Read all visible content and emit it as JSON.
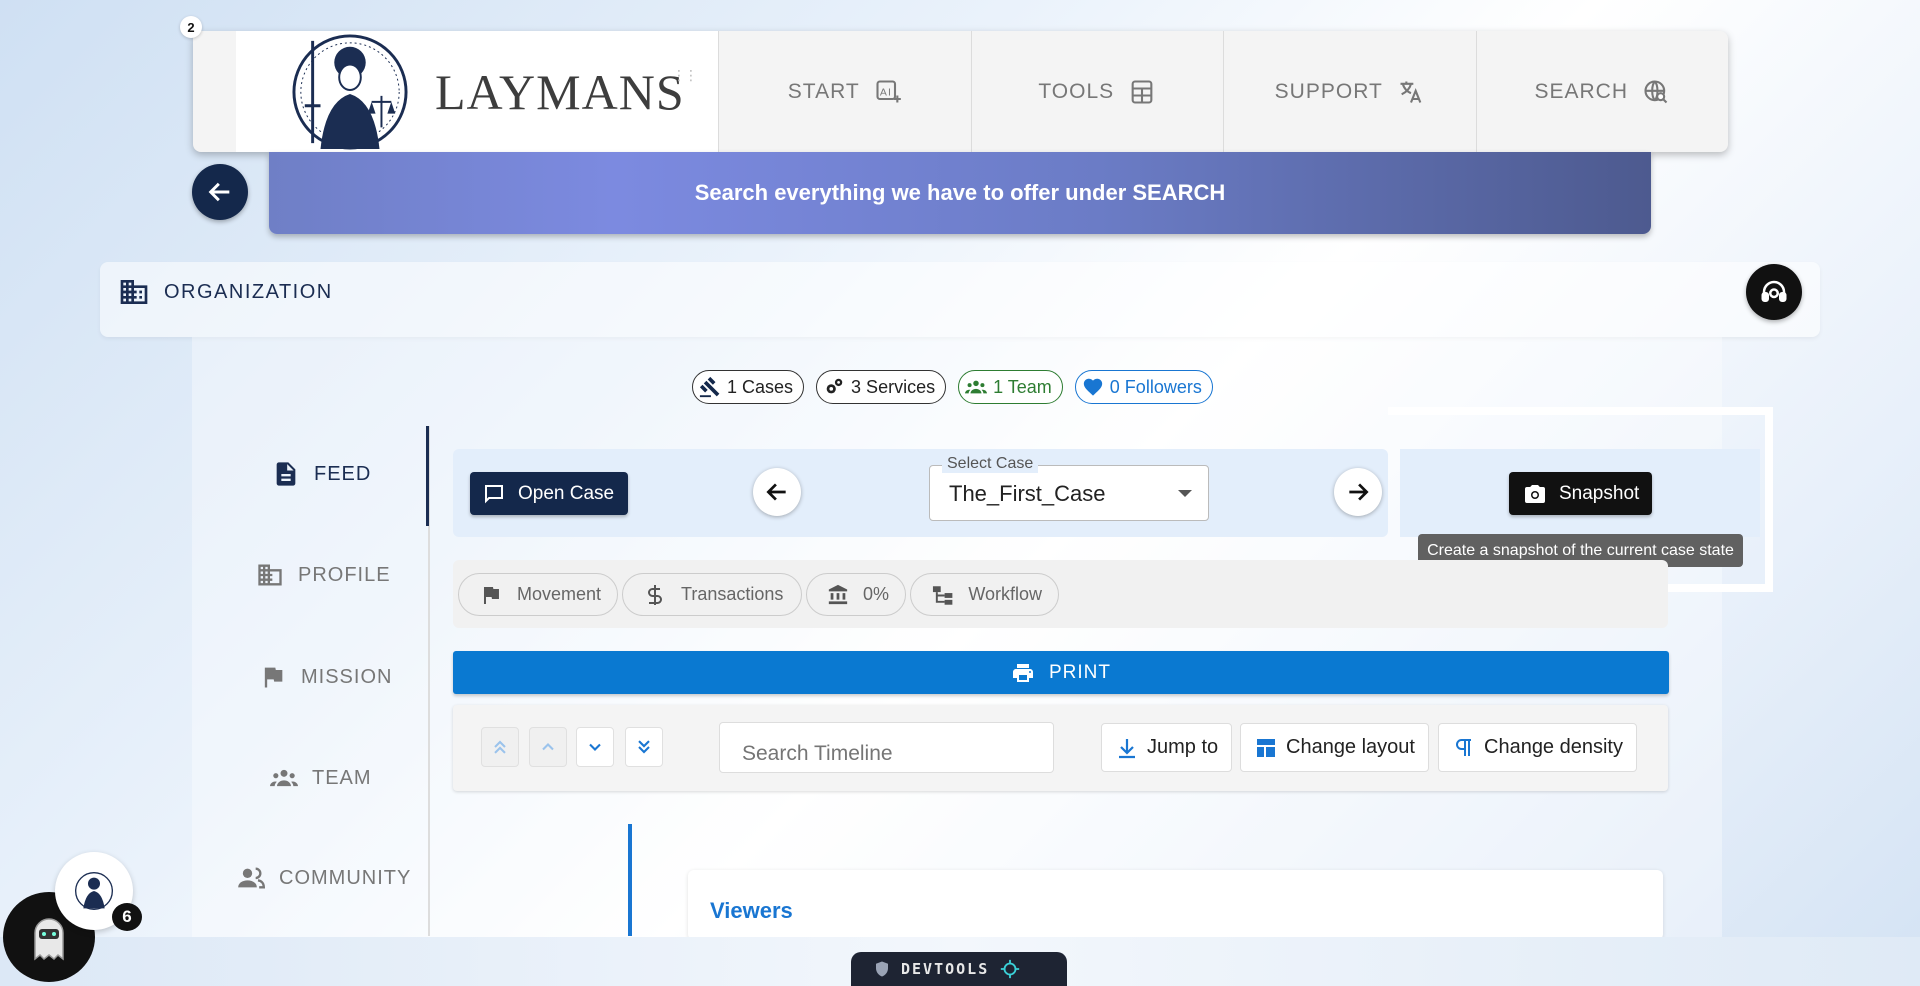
{
  "nav": {
    "badge": "2",
    "brand": "LAYMANS",
    "items": [
      {
        "label": "START",
        "icon": "ai-sparkle-icon"
      },
      {
        "label": "TOOLS",
        "icon": "calculator-icon"
      },
      {
        "label": "SUPPORT",
        "icon": "translate-icon"
      },
      {
        "label": "SEARCH",
        "icon": "globe-search-icon"
      }
    ]
  },
  "banner": {
    "text": "Search everything we have to offer under SEARCH"
  },
  "org": {
    "title": "ORGANIZATION"
  },
  "chips": {
    "cases": "1 Cases",
    "services": "3 Services",
    "team": "1 Team",
    "followers": "0 Followers"
  },
  "sidebar": {
    "items": [
      {
        "label": "FEED",
        "icon": "article-icon",
        "active": true
      },
      {
        "label": "PROFILE",
        "icon": "building-icon"
      },
      {
        "label": "MISSION",
        "icon": "flag-icon"
      },
      {
        "label": "TEAM",
        "icon": "groups-icon"
      },
      {
        "label": "COMMUNITY",
        "icon": "people-icon"
      }
    ]
  },
  "case": {
    "open_case": "Open Case",
    "select_label": "Select Case",
    "select_value": "The_First_Case",
    "snapshot": "Snapshot",
    "snapshot_tooltip": "Create a snapshot of the current case state"
  },
  "filters": {
    "movement": "Movement",
    "transactions": "Transactions",
    "percent": "0%",
    "workflow": "Workflow"
  },
  "print": {
    "label": "PRINT"
  },
  "timeline": {
    "search_placeholder": "Search Timeline",
    "jump_to": "Jump to",
    "change_layout": "Change layout",
    "change_density": "Change density",
    "card_title": "Viewers"
  },
  "notifications": {
    "count": "6"
  },
  "devtools": {
    "label": "DEVTOOLS"
  },
  "colors": {
    "navy": "#14284b",
    "primary_blue": "#0a79d1",
    "link_blue": "#1976d2",
    "green": "#2e7d32"
  }
}
